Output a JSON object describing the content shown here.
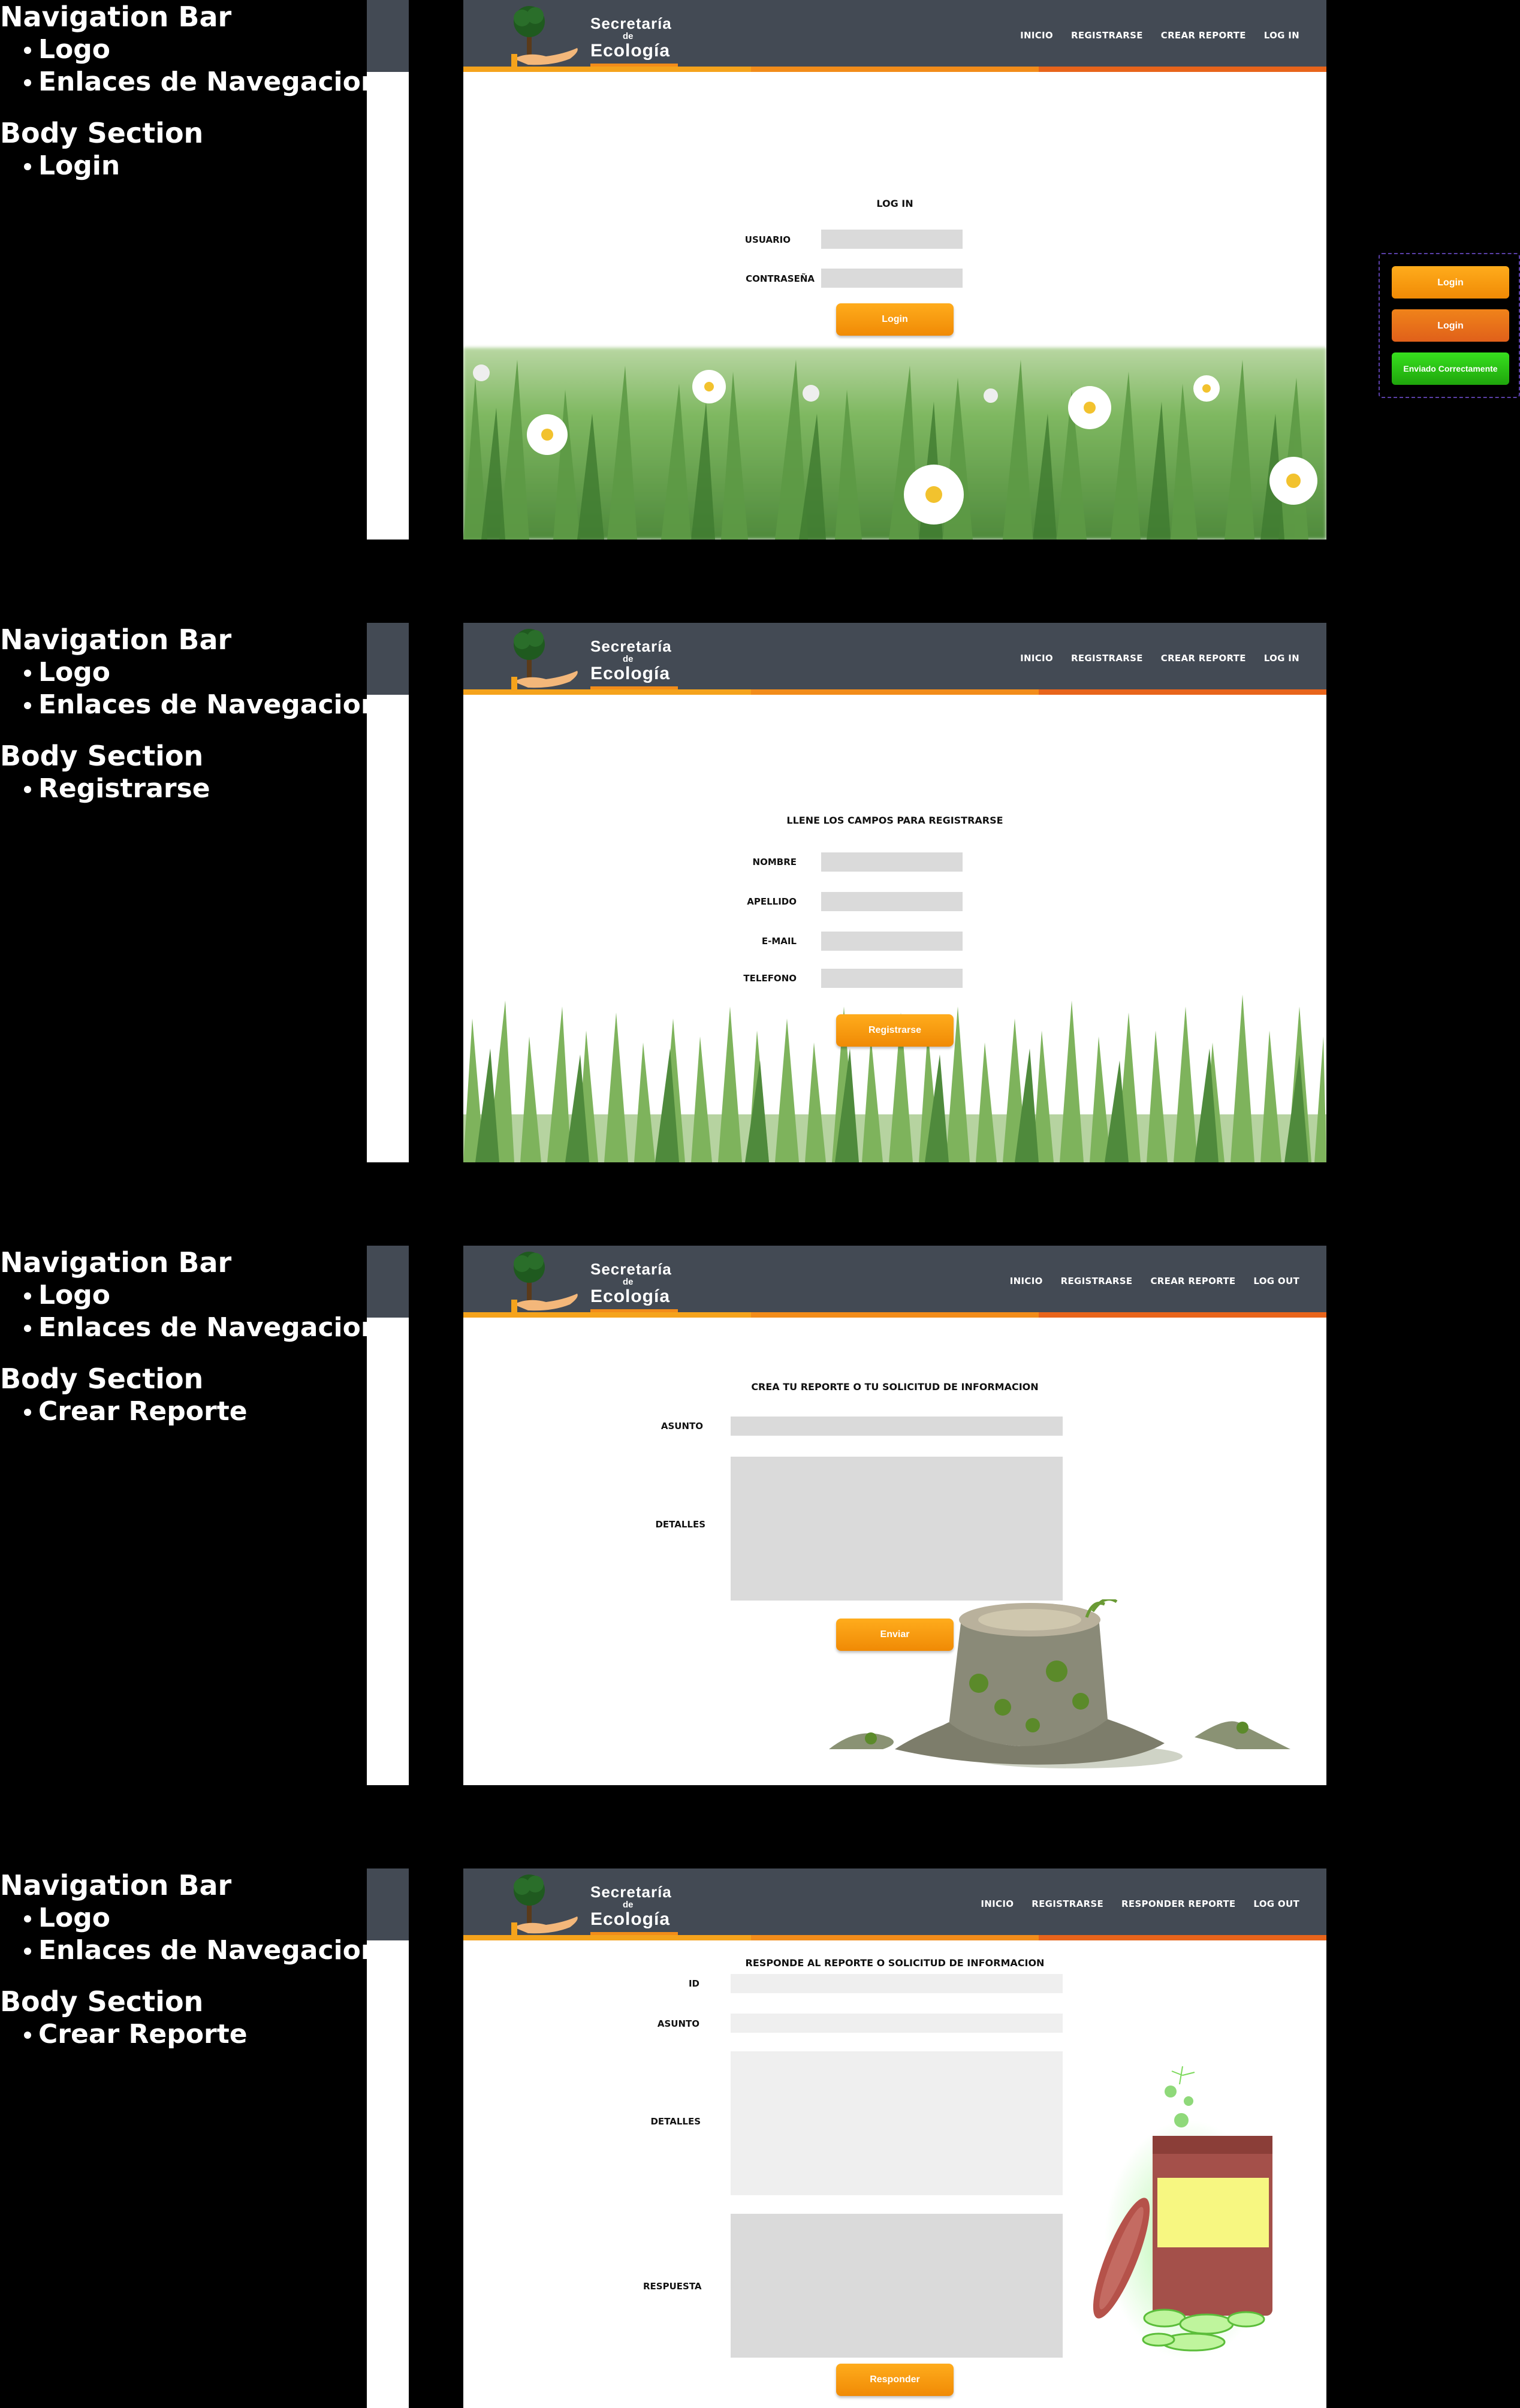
{
  "annotations": [
    {
      "nav_heading": "Navigation Bar",
      "nav_items": [
        "Logo",
        "Enlaces de Navegacion"
      ],
      "body_heading": "Body Section",
      "body_items": [
        "Login"
      ]
    },
    {
      "nav_heading": "Navigation Bar",
      "nav_items": [
        "Logo",
        "Enlaces de Navegacion"
      ],
      "body_heading": "Body Section",
      "body_items": [
        "Registrarse"
      ]
    },
    {
      "nav_heading": "Navigation Bar",
      "nav_items": [
        "Logo",
        "Enlaces de Navegacion"
      ],
      "body_heading": "Body Section",
      "body_items": [
        "Crear Reporte"
      ]
    },
    {
      "nav_heading": "Navigation Bar",
      "nav_items": [
        "Logo",
        "Enlaces de Navegacion"
      ],
      "body_heading": "Body Section",
      "body_items": [
        "Crear Reporte"
      ]
    }
  ],
  "logo": {
    "line1": "Secretaría",
    "line2": "de",
    "line3": "Ecología"
  },
  "colors": {
    "nav_bg": "#434a54",
    "accent_orange": "#f28c1a",
    "accent_red": "#e8641b",
    "field_gray": "#dadada",
    "success_green": "#2ecc1a"
  },
  "screens": {
    "login": {
      "nav_links": [
        "INICIO",
        "REGISTRARSE",
        "CREAR REPORTE",
        "LOG IN"
      ],
      "title": "LOG IN",
      "fields": [
        {
          "label": "USUARIO"
        },
        {
          "label": "CONTRASEÑA"
        }
      ],
      "button": "Login"
    },
    "register": {
      "nav_links": [
        "INICIO",
        "REGISTRARSE",
        "CREAR REPORTE",
        "LOG IN"
      ],
      "title": "LLENE LOS CAMPOS PARA REGISTRARSE",
      "fields": [
        {
          "label": "NOMBRE"
        },
        {
          "label": "APELLIDO"
        },
        {
          "label": "E-MAIL"
        },
        {
          "label": "TELEFONO"
        }
      ],
      "button": "Registrarse"
    },
    "report": {
      "nav_links": [
        "INICIO",
        "REGISTRARSE",
        "CREAR REPORTE",
        "LOG OUT"
      ],
      "title": "CREA TU REPORTE O TU SOLICITUD DE INFORMACION",
      "fields": [
        {
          "label": "ASUNTO"
        },
        {
          "label": "DETALLES"
        }
      ],
      "button": "Enviar"
    },
    "respond": {
      "nav_links": [
        "INICIO",
        "REGISTRARSE",
        "RESPONDER REPORTE",
        "LOG OUT"
      ],
      "title": "RESPONDE AL REPORTE O SOLICITUD DE INFORMACION",
      "fields": [
        {
          "label": "ID"
        },
        {
          "label": "ASUNTO"
        },
        {
          "label": "DETALLES"
        },
        {
          "label": "RESPUESTA"
        }
      ],
      "button": "Responder"
    }
  },
  "button_states": [
    {
      "label": "Login",
      "state": "default"
    },
    {
      "label": "Login",
      "state": "hover"
    },
    {
      "label": "Enviado Correctamente",
      "state": "success"
    }
  ]
}
